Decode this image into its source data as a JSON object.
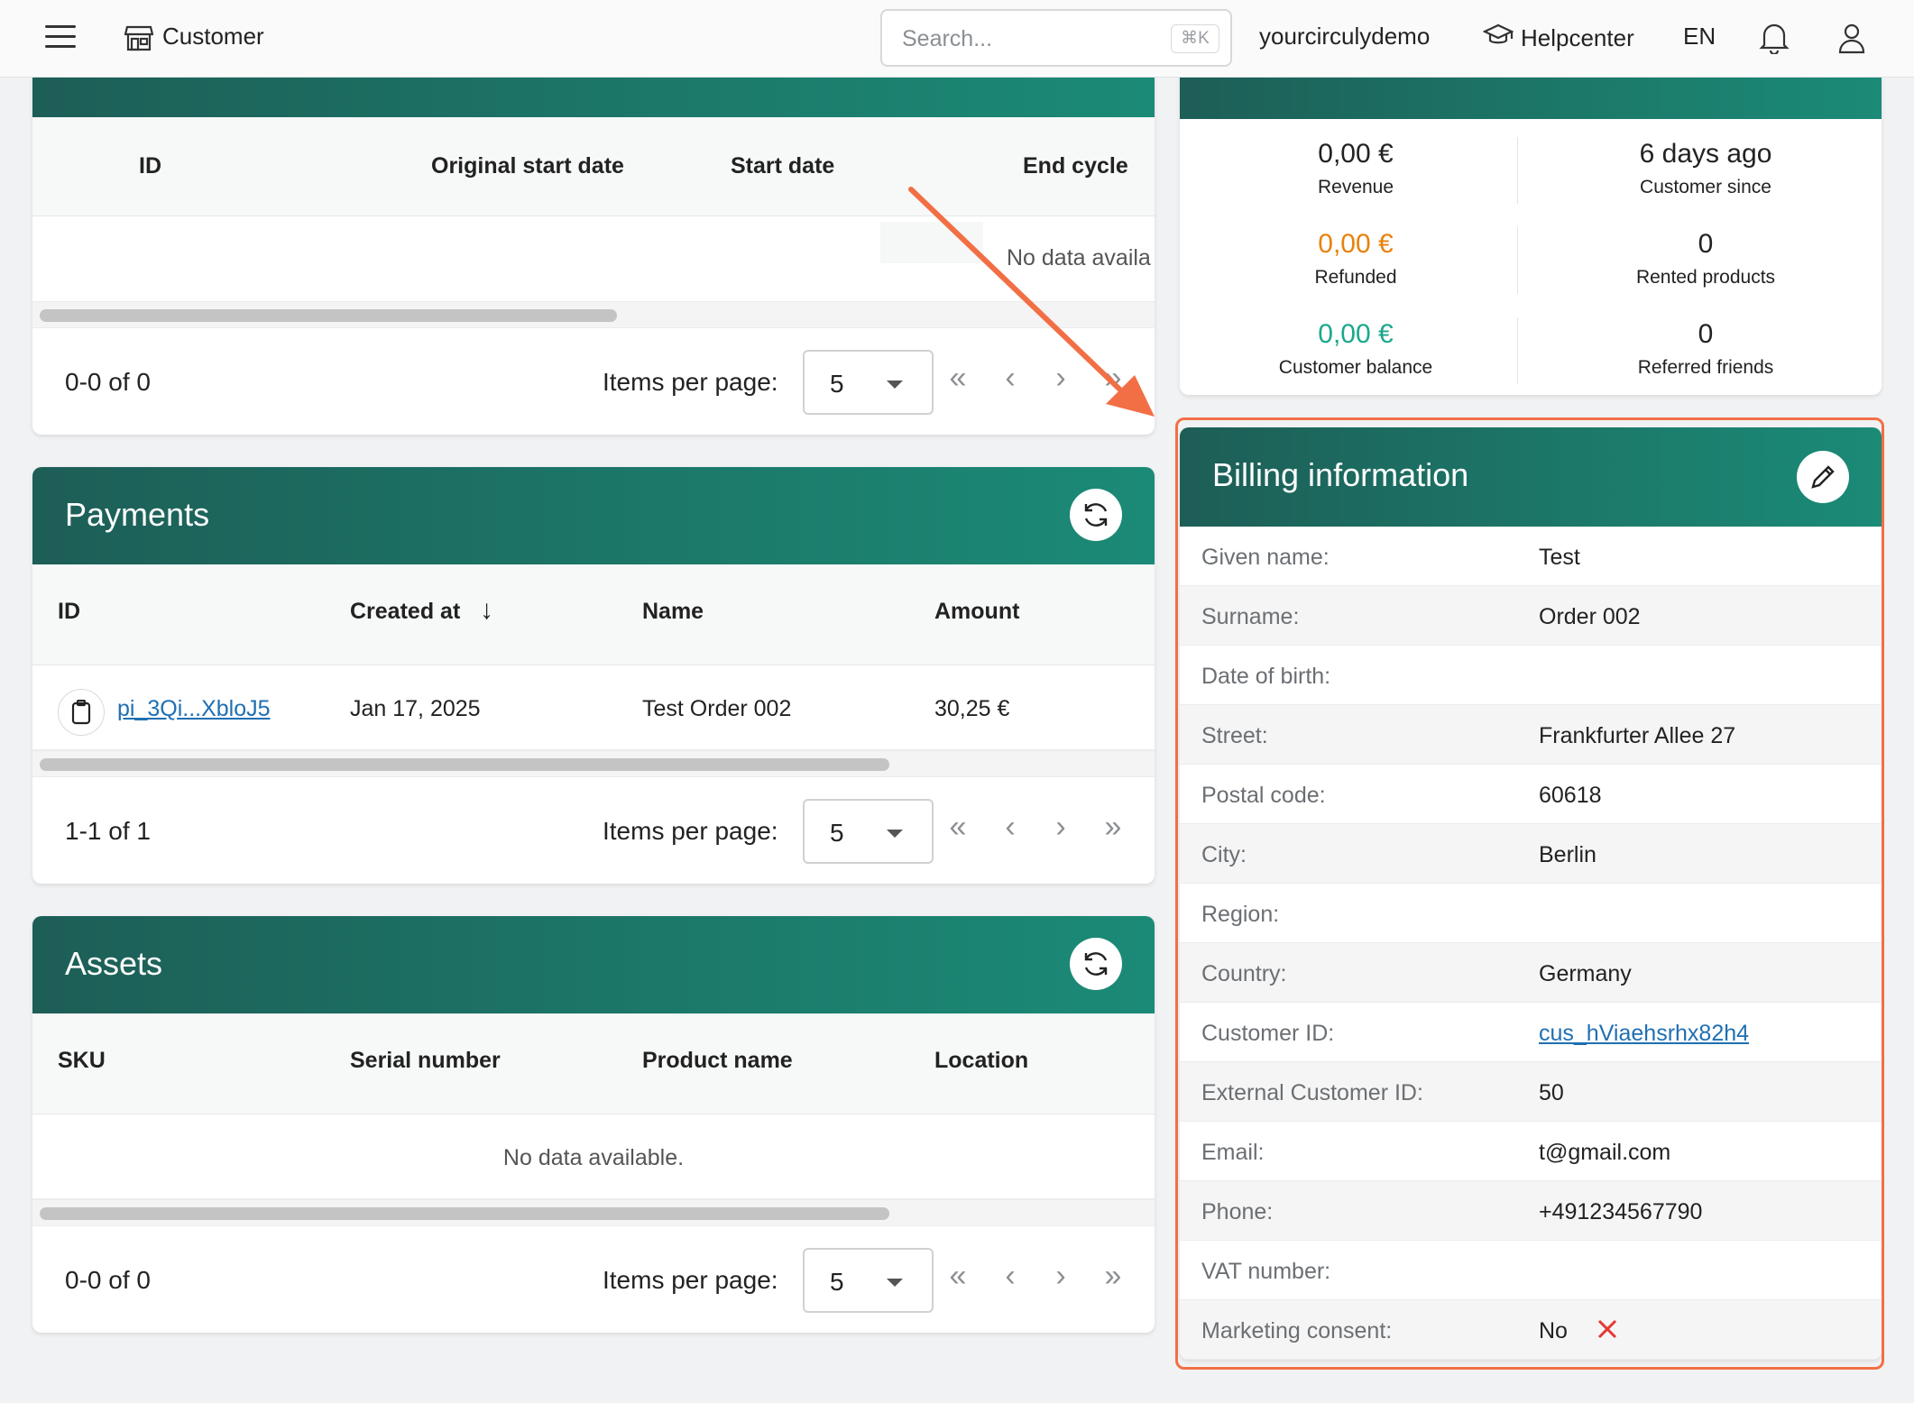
{
  "topbar": {
    "page_name": "Customer",
    "search_placeholder": "Search...",
    "search_shortcut": "⌘K",
    "account": "yourcirculydemo",
    "help": "Helpcenter",
    "language": "EN"
  },
  "subscriptions": {
    "columns": [
      "ID",
      "Original start date",
      "Start date",
      "End cycle"
    ],
    "empty_text": "No data availa",
    "range": "0-0 of 0",
    "items_per_page_label": "Items per page:",
    "items_per_page": "5"
  },
  "payments": {
    "title": "Payments",
    "columns": [
      "ID",
      "Created at",
      "Name",
      "Amount"
    ],
    "sort_indicator": "↓",
    "rows": [
      {
        "id": "pi_3Qi...XbloJ5",
        "created_at": "Jan 17, 2025",
        "name": "Test Order 002",
        "amount": "30,25 €"
      }
    ],
    "range": "1-1 of 1",
    "items_per_page_label": "Items per page:",
    "items_per_page": "5"
  },
  "assets": {
    "title": "Assets",
    "columns": [
      "SKU",
      "Serial number",
      "Product name",
      "Location"
    ],
    "empty_text": "No data available.",
    "range": "0-0 of 0",
    "items_per_page_label": "Items per page:",
    "items_per_page": "5"
  },
  "insights": {
    "items": [
      {
        "value": "0,00 €",
        "label": "Revenue",
        "color": "#222222"
      },
      {
        "value": "6 days ago",
        "label": "Customer since",
        "color": "#222222"
      },
      {
        "value": "0,00 €",
        "label": "Refunded",
        "color": "#e8820c"
      },
      {
        "value": "0",
        "label": "Rented products",
        "color": "#222222"
      },
      {
        "value": "0,00 €",
        "label": "Customer balance",
        "color": "#1ba88c"
      },
      {
        "value": "0",
        "label": "Referred friends",
        "color": "#222222"
      }
    ]
  },
  "billing": {
    "title": "Billing information",
    "rows": [
      {
        "label": "Given name:",
        "value": "Test"
      },
      {
        "label": "Surname:",
        "value": "Order 002"
      },
      {
        "label": "Date of birth:",
        "value": ""
      },
      {
        "label": "Street:",
        "value": "Frankfurter Allee 27"
      },
      {
        "label": "Postal code:",
        "value": "60618"
      },
      {
        "label": "City:",
        "value": "Berlin"
      },
      {
        "label": "Region:",
        "value": ""
      },
      {
        "label": "Country:",
        "value": "Germany"
      },
      {
        "label": "Customer ID:",
        "value": "cus_hViaehsrhx82h4"
      },
      {
        "label": "External Customer ID:",
        "value": "50"
      },
      {
        "label": "Email:",
        "value": "t@gmail.com"
      },
      {
        "label": "Phone:",
        "value": "+491234567790"
      },
      {
        "label": "VAT number:",
        "value": ""
      },
      {
        "label": "Marketing consent:",
        "value": "No"
      }
    ]
  },
  "colors": {
    "header_gradient_start": "#1d5e57",
    "header_gradient_end": "#1b8a77",
    "highlight": "#f26f45",
    "link": "#1f6fb2",
    "refunded": "#e8820c",
    "balance": "#1ba88c",
    "consent_no": "#e53935"
  }
}
